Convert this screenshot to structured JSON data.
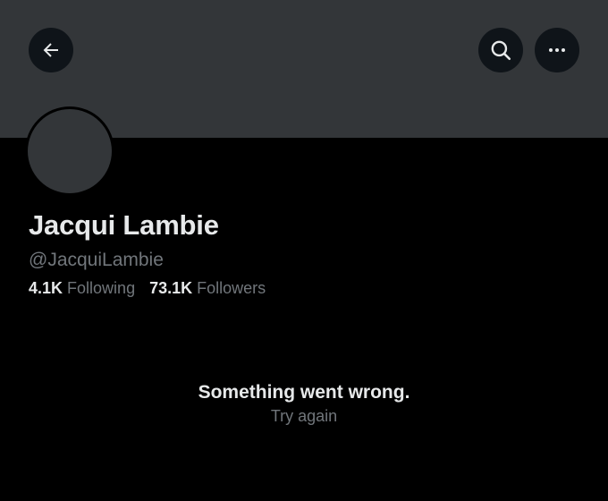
{
  "profile": {
    "name": "Jacqui Lambie",
    "handle": "@JacquiLambie",
    "following_count": "4.1K",
    "following_label": "Following",
    "followers_count": "73.1K",
    "followers_label": "Followers"
  },
  "header": {
    "back_icon": "arrow-left-icon",
    "search_icon": "search-icon",
    "more_icon": "more-horizontal-icon"
  },
  "error": {
    "message": "Something went wrong.",
    "retry_label": "Try again"
  },
  "colors": {
    "background": "#000000",
    "banner": "#333639",
    "button_bg": "#0f1419",
    "primary_text": "#e7e9ea",
    "secondary_text": "#71767b"
  }
}
